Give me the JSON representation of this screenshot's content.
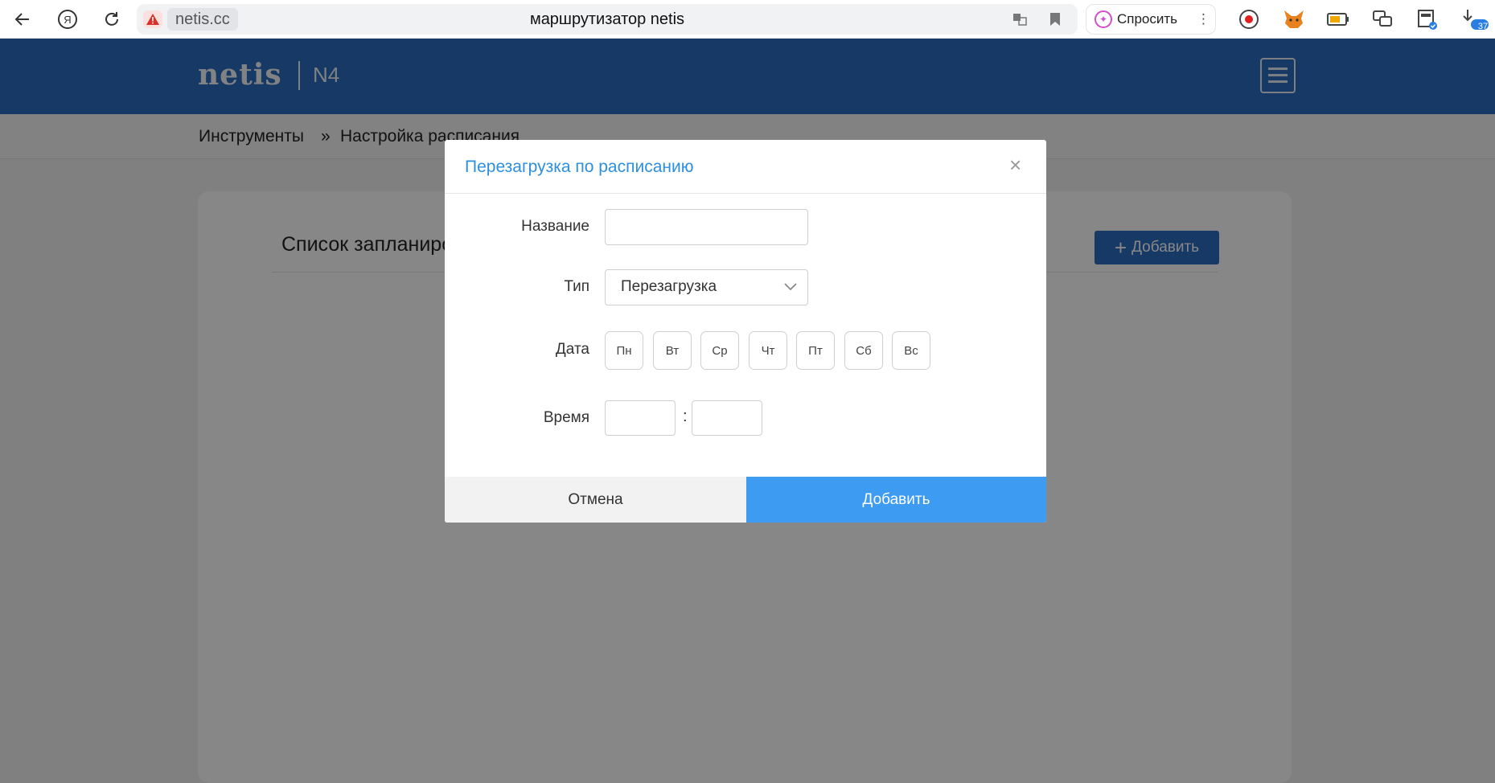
{
  "browser": {
    "domain": "netis.cc",
    "page_title": "маршрутизатор netis",
    "ask_label": "Спросить",
    "downloads_badge": "37"
  },
  "router": {
    "brand": "netis",
    "model": "N4",
    "breadcrumb": [
      "Инструменты",
      "»",
      "Настройка расписания"
    ]
  },
  "card": {
    "title": "Список запланированных задач",
    "add_label": "Добавить"
  },
  "modal": {
    "title": "Перезагрузка по расписанию",
    "close": "×",
    "labels": {
      "name": "Название",
      "type": "Тип",
      "date": "Дата",
      "time": "Время"
    },
    "name_value": "",
    "type_value": "Перезагрузка",
    "days": [
      "Пн",
      "Вт",
      "Ср",
      "Чт",
      "Пт",
      "Сб",
      "Вс"
    ],
    "hour_value": "",
    "minute_value": "",
    "time_separator": ":",
    "cancel_label": "Отмена",
    "submit_label": "Добавить"
  },
  "colors": {
    "header": "#2d6dbf",
    "modal_title": "#2d8fe0",
    "submit": "#3d9cf2"
  }
}
